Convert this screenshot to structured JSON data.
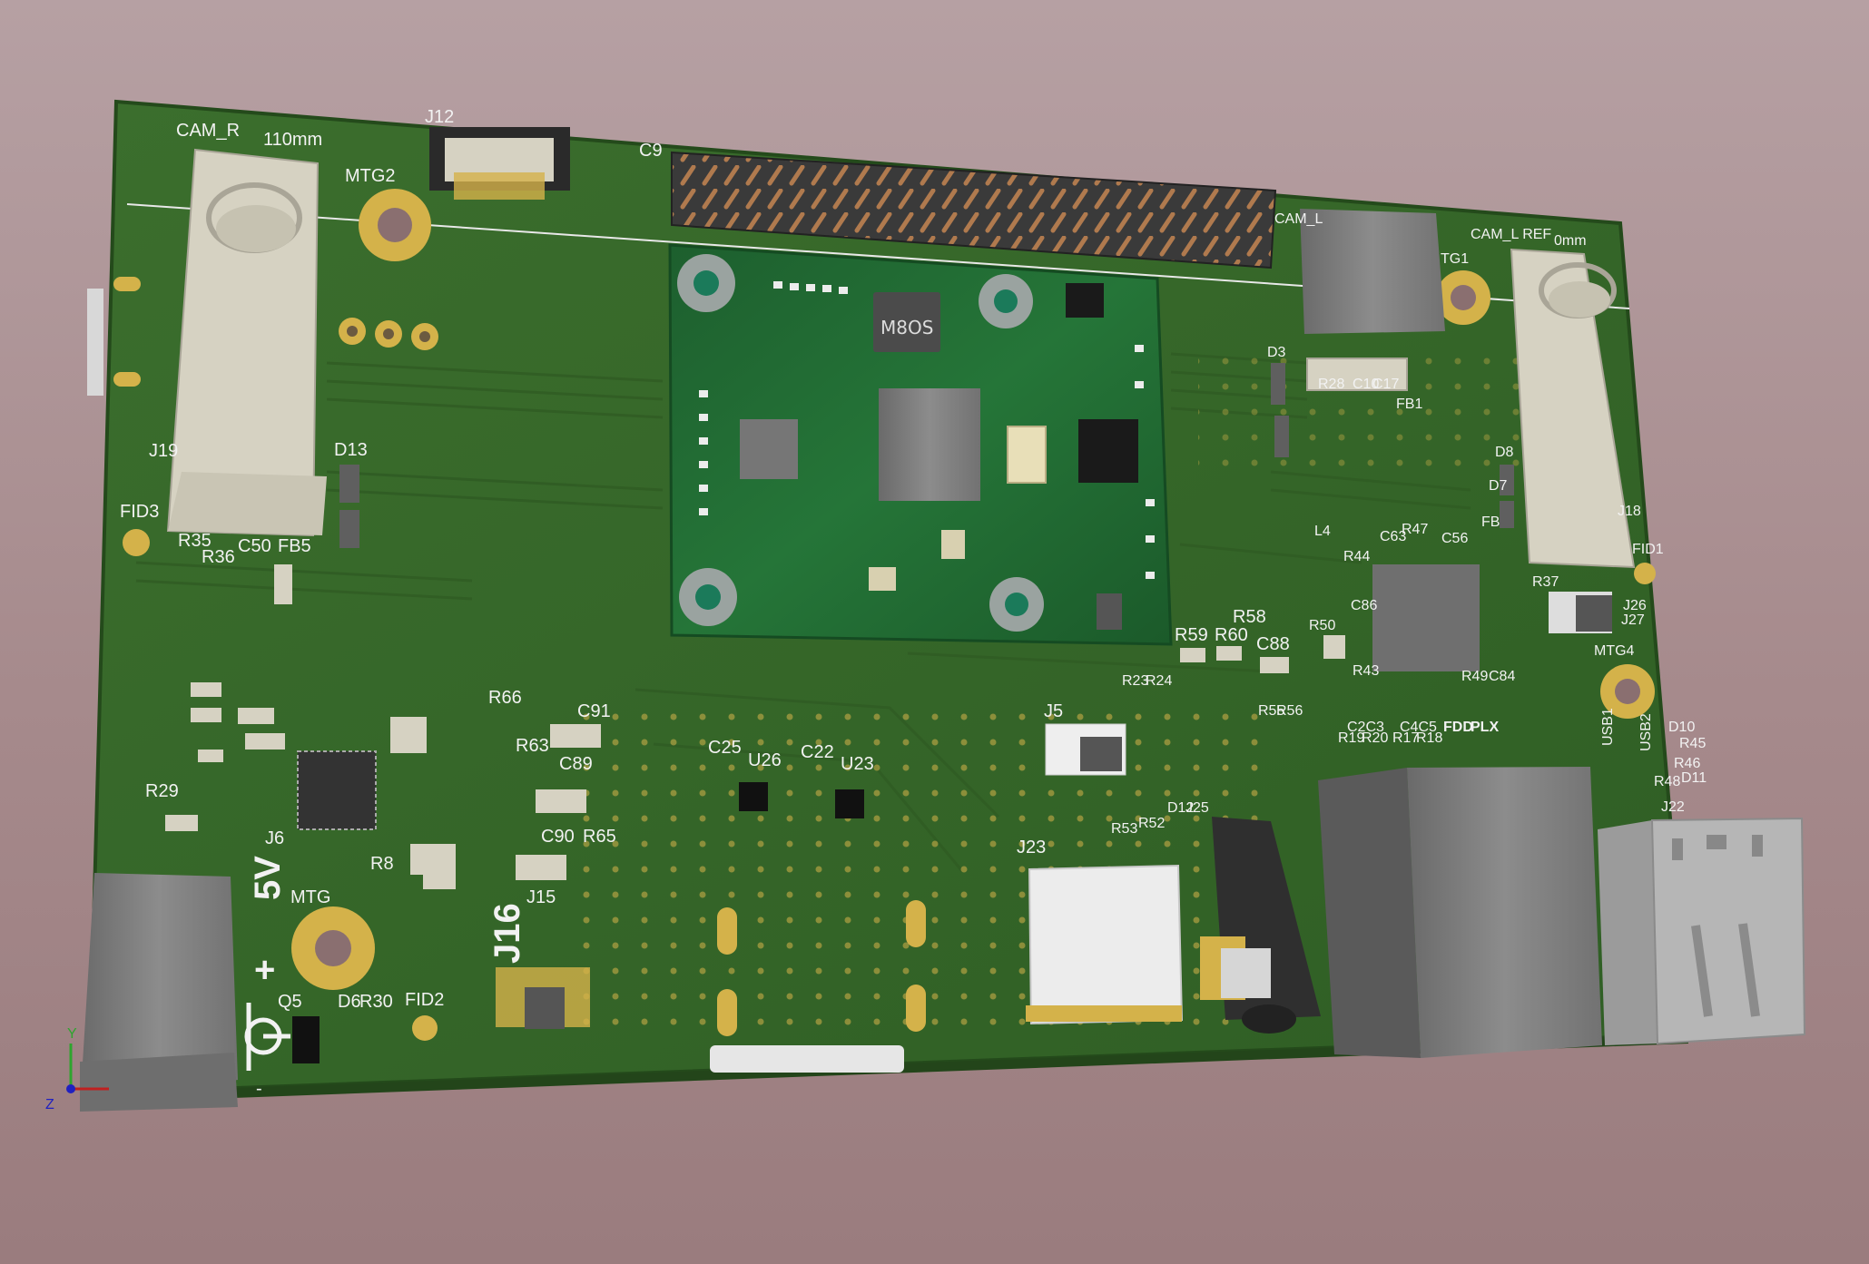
{
  "board": {
    "labels": {
      "cam_r": "CAM_R",
      "dim_110": "110mm",
      "j12": "J12",
      "mtg2": "MTG2",
      "c9": "C9",
      "cam_l_ref": "CAM_L REF",
      "dim_0": "0mm",
      "cam_l_partial": "CAM_L",
      "tg1": "TG1",
      "d3": "D3",
      "r28": "R28",
      "c10": "C10",
      "c17": "C17",
      "fb1": "FB1",
      "d8": "D8",
      "d7": "D7",
      "fb": "FB",
      "j18": "J18",
      "fid1": "FID1",
      "r37": "R37",
      "j26": "J26",
      "j27": "J27",
      "mtg4": "MTG4",
      "l4": "L4",
      "c63": "C63",
      "r47": "R47",
      "c56": "C56",
      "r44": "R44",
      "c86": "C86",
      "r50": "R50",
      "r43": "R43",
      "r49": "R49",
      "c84": "C84",
      "j19": "J19",
      "d13": "D13",
      "fid3": "FID3",
      "r35": "R35",
      "r36": "R36",
      "c50": "C50",
      "fb5": "FB5",
      "r59": "R59",
      "r60": "R60",
      "r58": "R58",
      "c88": "C88",
      "r23": "R23",
      "r24": "R24",
      "r55": "R55",
      "r56": "R56",
      "c2c3": "C2C3",
      "c4c5": "C4C5",
      "r19": "R19",
      "r20": "R20",
      "r17": "R17",
      "r18": "R18",
      "fdd": "FDD",
      "plx": "PLX",
      "usb1": "USB1",
      "usb2": "USB2",
      "d10": "D10",
      "r45": "R45",
      "r46": "R46",
      "r48": "R48",
      "d11": "D11",
      "j22": "J22",
      "r66": "R66",
      "c91": "C91",
      "r63": "R63",
      "c89": "C89",
      "c25": "C25",
      "u26": "U26",
      "c22": "C22",
      "u23": "U23",
      "j5": "J5",
      "r29": "R29",
      "j6": "J6",
      "mtg": "MTG",
      "c90": "C90",
      "r65": "R65",
      "j15": "J15",
      "r53": "R53",
      "r52": "R52",
      "d12": "D12",
      "j25": "J25",
      "j23": "J23",
      "v5": "5V",
      "plus": "+",
      "minus": "-",
      "q5": "Q5",
      "d6": "D6",
      "r30": "R30",
      "fid2": "FID2",
      "j16": "J16",
      "r8": "R8"
    },
    "module_marking": "M8OS",
    "axis": {
      "y": "Y",
      "z": "Z"
    }
  },
  "colors": {
    "board": "#37672a",
    "board_dark": "#2a521f",
    "module": "#1f6a33",
    "pad_gold": "#d4b24a",
    "pin_copper": "#b07a4e",
    "metal_grey": "#8a8a8a",
    "connector_beige": "#d6d2c2",
    "silkscreen": "#f2f2f2"
  }
}
